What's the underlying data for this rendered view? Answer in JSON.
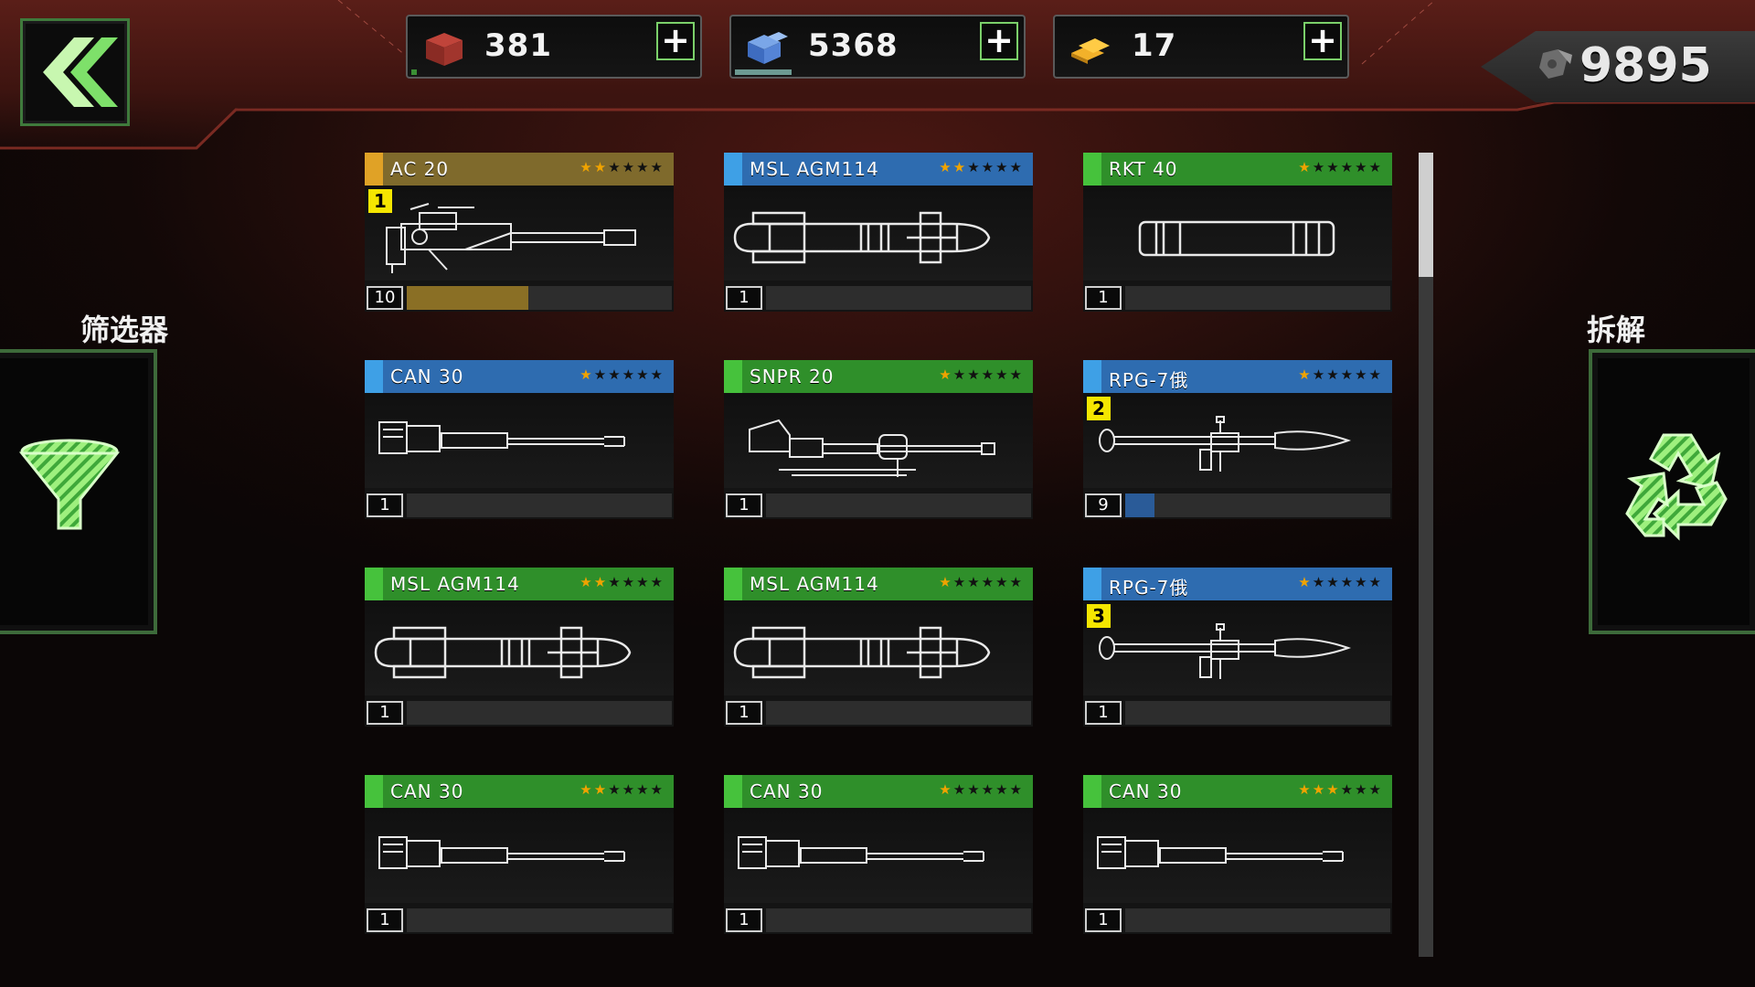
{
  "resources": [
    {
      "name": "supply-crate",
      "value": "381",
      "bar_fraction": 0.02
    },
    {
      "name": "blue-crystal",
      "value": "5368",
      "bar_fraction": 0.2
    },
    {
      "name": "gold-bars",
      "value": "17",
      "bar_fraction": 0
    }
  ],
  "currency": {
    "value": "9895",
    "icon": "hex-bolt-icon"
  },
  "filter": {
    "label": "筛选器",
    "icon": "funnel-icon"
  },
  "dismantle": {
    "label": "拆解",
    "icon": "recycle-icon"
  },
  "back": {
    "icon": "double-chevron-left-icon"
  },
  "colors": {
    "gold_header": "#7f6a2c",
    "gold_accent": "#e0a226",
    "blue_header": "#2e6cb0",
    "blue_accent": "#3ea0e6",
    "green_header": "#2f8f2a",
    "green_accent": "#46c23c",
    "gold_bar": "#8a6f25",
    "blue_bar": "#2a5b98"
  },
  "items": [
    {
      "name": "AC 20",
      "rarity": "gold",
      "stars": 2,
      "level": "10",
      "progress": 0.46,
      "slot": "1",
      "art": "autocannon"
    },
    {
      "name": "MSL AGM114",
      "rarity": "blue",
      "stars": 2,
      "level": "1",
      "progress": 0,
      "slot": "",
      "art": "missile"
    },
    {
      "name": "RKT 40",
      "rarity": "green",
      "stars": 1,
      "level": "1",
      "progress": 0,
      "slot": "",
      "art": "rocket-pod"
    },
    {
      "name": "CAN 30",
      "rarity": "blue",
      "stars": 1,
      "level": "1",
      "progress": 0,
      "slot": "",
      "art": "cannon"
    },
    {
      "name": "SNPR 20",
      "rarity": "green",
      "stars": 1,
      "level": "1",
      "progress": 0,
      "slot": "",
      "art": "sniper"
    },
    {
      "name": "RPG-7俄",
      "rarity": "blue",
      "stars": 1,
      "level": "9",
      "progress": 0.11,
      "slot": "2",
      "art": "rpg"
    },
    {
      "name": "MSL AGM114",
      "rarity": "green",
      "stars": 2,
      "level": "1",
      "progress": 0,
      "slot": "",
      "art": "missile"
    },
    {
      "name": "MSL AGM114",
      "rarity": "green",
      "stars": 1,
      "level": "1",
      "progress": 0,
      "slot": "",
      "art": "missile"
    },
    {
      "name": "RPG-7俄",
      "rarity": "blue",
      "stars": 1,
      "level": "1",
      "progress": 0,
      "slot": "3",
      "art": "rpg"
    },
    {
      "name": "CAN 30",
      "rarity": "green",
      "stars": 2,
      "level": "1",
      "progress": 0,
      "slot": "",
      "art": "cannon"
    },
    {
      "name": "CAN 30",
      "rarity": "green",
      "stars": 1,
      "level": "1",
      "progress": 0,
      "slot": "",
      "art": "cannon"
    },
    {
      "name": "CAN 30",
      "rarity": "green",
      "stars": 3,
      "level": "1",
      "progress": 0,
      "slot": "",
      "art": "cannon"
    }
  ],
  "max_stars": 6,
  "scroll": {
    "position": 0
  }
}
